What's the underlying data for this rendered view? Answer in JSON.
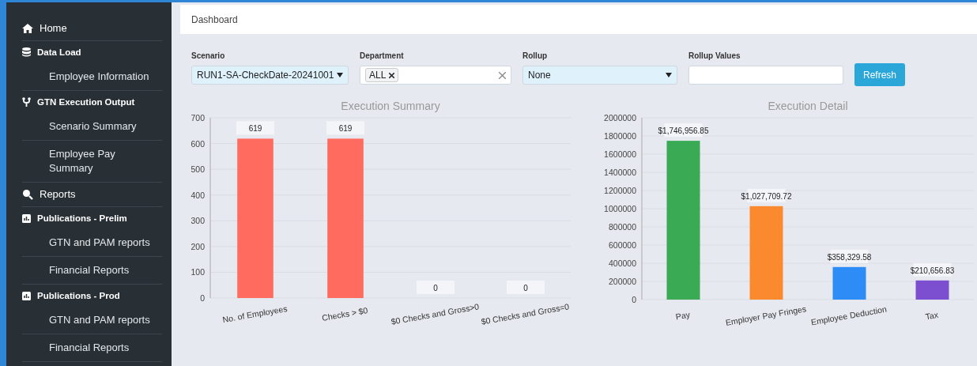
{
  "sidebar": {
    "items": [
      {
        "label": "Home",
        "kind": "top"
      },
      {
        "label": "Data Load",
        "kind": "section"
      },
      {
        "label": "Employee Information",
        "kind": "sub"
      },
      {
        "label": "GTN Execution Output",
        "kind": "section"
      },
      {
        "label": "Scenario Summary",
        "kind": "sub"
      },
      {
        "label": "Employee Pay Summary",
        "kind": "sub"
      },
      {
        "label": "Reports",
        "kind": "top"
      },
      {
        "label": "Publications - Prelim",
        "kind": "section"
      },
      {
        "label": "GTN and PAM reports",
        "kind": "sub"
      },
      {
        "label": "Financial Reports",
        "kind": "sub"
      },
      {
        "label": "Publications - Prod",
        "kind": "section"
      },
      {
        "label": "GTN and PAM reports",
        "kind": "sub"
      },
      {
        "label": "Financial Reports",
        "kind": "sub"
      }
    ]
  },
  "breadcrumb": "Dashboard",
  "filters": {
    "scenario": {
      "label": "Scenario",
      "value": "RUN1-SA-CheckDate-20241001"
    },
    "department": {
      "label": "Department",
      "tags": [
        "ALL"
      ]
    },
    "rollup": {
      "label": "Rollup",
      "value": "None"
    },
    "rollup_values": {
      "label": "Rollup Values"
    },
    "refresh": "Refresh"
  },
  "charts": [
    {
      "chart_data": {
        "type": "bar",
        "title": "Execution Summary",
        "categories": [
          "No. of Employees",
          "Checks > $0",
          "$0 Checks and Gross>0",
          "$0 Checks and Gross=0"
        ],
        "series": [
          {
            "color": "#ff6b5e",
            "values": [
              619,
              619,
              0,
              0
            ]
          }
        ],
        "grid": true,
        "ylim": [
          0,
          700
        ],
        "yticks": [
          0,
          100,
          200,
          300,
          400,
          500,
          600,
          700
        ],
        "value_labels": [
          "619",
          "619",
          "0",
          "0"
        ]
      }
    },
    {
      "chart_data": {
        "type": "bar",
        "title": "Execution Detail",
        "categories": [
          "Pay",
          "Employer Pay Fringes",
          "Employee Deduction",
          "Tax"
        ],
        "series": [
          {
            "values": [
              1746957,
              1027710,
              358330,
              210657
            ]
          }
        ],
        "grid": true,
        "colors": [
          "#3aaa55",
          "#fb8a2e",
          "#2d8cf5",
          "#7b4fcf"
        ],
        "ylim": [
          0,
          2000000
        ],
        "yticks": [
          0,
          200000,
          400000,
          600000,
          800000,
          1000000,
          1200000,
          1400000,
          1600000,
          1800000,
          2000000
        ],
        "value_labels": [
          "$1,746,956.85",
          "$1,027,709.72",
          "$358,329.58",
          "$210,656.83"
        ]
      }
    }
  ]
}
